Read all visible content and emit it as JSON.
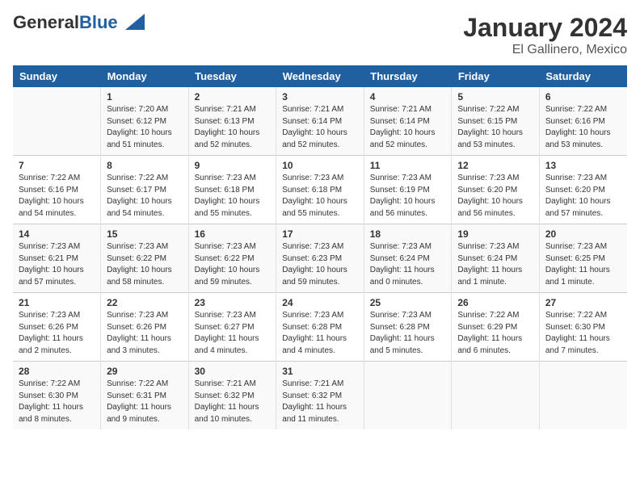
{
  "header": {
    "logo_general": "General",
    "logo_blue": "Blue",
    "main_title": "January 2024",
    "sub_title": "El Gallinero, Mexico"
  },
  "columns": [
    "Sunday",
    "Monday",
    "Tuesday",
    "Wednesday",
    "Thursday",
    "Friday",
    "Saturday"
  ],
  "weeks": [
    [
      {
        "day": "",
        "info": ""
      },
      {
        "day": "1",
        "info": "Sunrise: 7:20 AM\nSunset: 6:12 PM\nDaylight: 10 hours\nand 51 minutes."
      },
      {
        "day": "2",
        "info": "Sunrise: 7:21 AM\nSunset: 6:13 PM\nDaylight: 10 hours\nand 52 minutes."
      },
      {
        "day": "3",
        "info": "Sunrise: 7:21 AM\nSunset: 6:14 PM\nDaylight: 10 hours\nand 52 minutes."
      },
      {
        "day": "4",
        "info": "Sunrise: 7:21 AM\nSunset: 6:14 PM\nDaylight: 10 hours\nand 52 minutes."
      },
      {
        "day": "5",
        "info": "Sunrise: 7:22 AM\nSunset: 6:15 PM\nDaylight: 10 hours\nand 53 minutes."
      },
      {
        "day": "6",
        "info": "Sunrise: 7:22 AM\nSunset: 6:16 PM\nDaylight: 10 hours\nand 53 minutes."
      }
    ],
    [
      {
        "day": "7",
        "info": "Sunrise: 7:22 AM\nSunset: 6:16 PM\nDaylight: 10 hours\nand 54 minutes."
      },
      {
        "day": "8",
        "info": "Sunrise: 7:22 AM\nSunset: 6:17 PM\nDaylight: 10 hours\nand 54 minutes."
      },
      {
        "day": "9",
        "info": "Sunrise: 7:23 AM\nSunset: 6:18 PM\nDaylight: 10 hours\nand 55 minutes."
      },
      {
        "day": "10",
        "info": "Sunrise: 7:23 AM\nSunset: 6:18 PM\nDaylight: 10 hours\nand 55 minutes."
      },
      {
        "day": "11",
        "info": "Sunrise: 7:23 AM\nSunset: 6:19 PM\nDaylight: 10 hours\nand 56 minutes."
      },
      {
        "day": "12",
        "info": "Sunrise: 7:23 AM\nSunset: 6:20 PM\nDaylight: 10 hours\nand 56 minutes."
      },
      {
        "day": "13",
        "info": "Sunrise: 7:23 AM\nSunset: 6:20 PM\nDaylight: 10 hours\nand 57 minutes."
      }
    ],
    [
      {
        "day": "14",
        "info": "Sunrise: 7:23 AM\nSunset: 6:21 PM\nDaylight: 10 hours\nand 57 minutes."
      },
      {
        "day": "15",
        "info": "Sunrise: 7:23 AM\nSunset: 6:22 PM\nDaylight: 10 hours\nand 58 minutes."
      },
      {
        "day": "16",
        "info": "Sunrise: 7:23 AM\nSunset: 6:22 PM\nDaylight: 10 hours\nand 59 minutes."
      },
      {
        "day": "17",
        "info": "Sunrise: 7:23 AM\nSunset: 6:23 PM\nDaylight: 10 hours\nand 59 minutes."
      },
      {
        "day": "18",
        "info": "Sunrise: 7:23 AM\nSunset: 6:24 PM\nDaylight: 11 hours\nand 0 minutes."
      },
      {
        "day": "19",
        "info": "Sunrise: 7:23 AM\nSunset: 6:24 PM\nDaylight: 11 hours\nand 1 minute."
      },
      {
        "day": "20",
        "info": "Sunrise: 7:23 AM\nSunset: 6:25 PM\nDaylight: 11 hours\nand 1 minute."
      }
    ],
    [
      {
        "day": "21",
        "info": "Sunrise: 7:23 AM\nSunset: 6:26 PM\nDaylight: 11 hours\nand 2 minutes."
      },
      {
        "day": "22",
        "info": "Sunrise: 7:23 AM\nSunset: 6:26 PM\nDaylight: 11 hours\nand 3 minutes."
      },
      {
        "day": "23",
        "info": "Sunrise: 7:23 AM\nSunset: 6:27 PM\nDaylight: 11 hours\nand 4 minutes."
      },
      {
        "day": "24",
        "info": "Sunrise: 7:23 AM\nSunset: 6:28 PM\nDaylight: 11 hours\nand 4 minutes."
      },
      {
        "day": "25",
        "info": "Sunrise: 7:23 AM\nSunset: 6:28 PM\nDaylight: 11 hours\nand 5 minutes."
      },
      {
        "day": "26",
        "info": "Sunrise: 7:22 AM\nSunset: 6:29 PM\nDaylight: 11 hours\nand 6 minutes."
      },
      {
        "day": "27",
        "info": "Sunrise: 7:22 AM\nSunset: 6:30 PM\nDaylight: 11 hours\nand 7 minutes."
      }
    ],
    [
      {
        "day": "28",
        "info": "Sunrise: 7:22 AM\nSunset: 6:30 PM\nDaylight: 11 hours\nand 8 minutes."
      },
      {
        "day": "29",
        "info": "Sunrise: 7:22 AM\nSunset: 6:31 PM\nDaylight: 11 hours\nand 9 minutes."
      },
      {
        "day": "30",
        "info": "Sunrise: 7:21 AM\nSunset: 6:32 PM\nDaylight: 11 hours\nand 10 minutes."
      },
      {
        "day": "31",
        "info": "Sunrise: 7:21 AM\nSunset: 6:32 PM\nDaylight: 11 hours\nand 11 minutes."
      },
      {
        "day": "",
        "info": ""
      },
      {
        "day": "",
        "info": ""
      },
      {
        "day": "",
        "info": ""
      }
    ]
  ]
}
